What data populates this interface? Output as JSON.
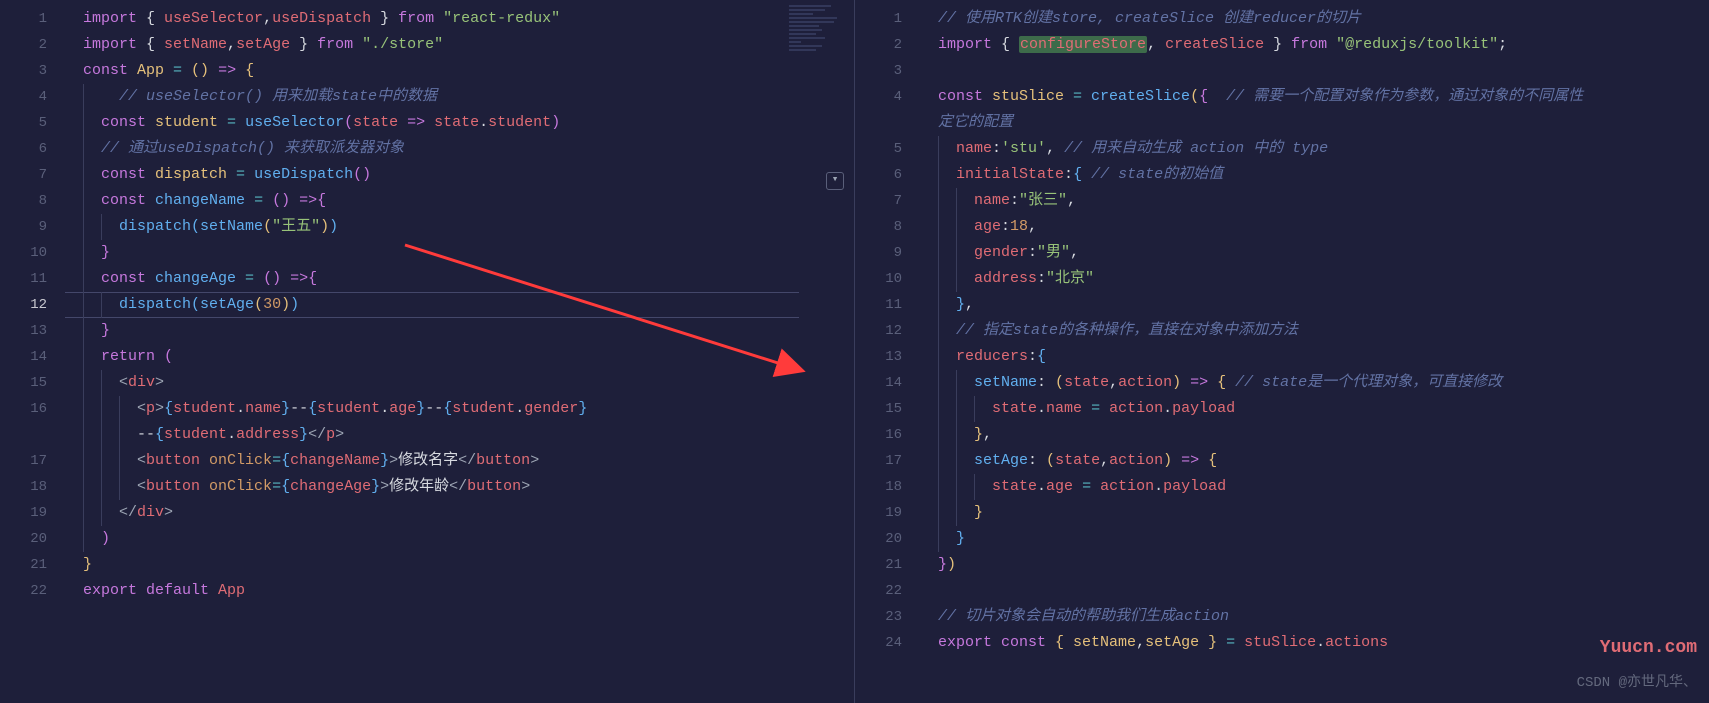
{
  "left": {
    "line_count": 22,
    "current_line": 12,
    "tokens": {
      "l1": [
        {
          "c": "k-purple",
          "t": "import "
        },
        {
          "c": "k-punc",
          "t": "{ "
        },
        {
          "c": "k-red",
          "t": "useSelector"
        },
        {
          "c": "k-punc",
          "t": ","
        },
        {
          "c": "k-red",
          "t": "useDispatch "
        },
        {
          "c": "k-punc",
          "t": "} "
        },
        {
          "c": "k-purple",
          "t": "from "
        },
        {
          "c": "k-green",
          "t": "\"react-redux\""
        }
      ],
      "l2": [
        {
          "c": "k-purple",
          "t": "import "
        },
        {
          "c": "k-punc",
          "t": "{ "
        },
        {
          "c": "k-red",
          "t": "setName"
        },
        {
          "c": "k-punc",
          "t": ","
        },
        {
          "c": "k-red",
          "t": "setAge "
        },
        {
          "c": "k-punc",
          "t": "} "
        },
        {
          "c": "k-purple",
          "t": "from "
        },
        {
          "c": "k-green",
          "t": "\"./store\""
        }
      ],
      "l3": [
        {
          "c": "k-purple",
          "t": "const "
        },
        {
          "c": "k-yellow",
          "t": "App "
        },
        {
          "c": "k-aqua",
          "t": "= "
        },
        {
          "c": "k-paren-yellow",
          "t": "() "
        },
        {
          "c": "k-purple",
          "t": "=> "
        },
        {
          "c": "k-paren-yellow",
          "t": "{"
        }
      ],
      "l4": [
        {
          "c": "",
          "t": "    "
        },
        {
          "c": "k-comment",
          "t": "// useSelector() 用来加载state中的数据"
        }
      ],
      "l5": [
        {
          "c": "",
          "t": "  "
        },
        {
          "c": "k-purple",
          "t": "const "
        },
        {
          "c": "k-yellow",
          "t": "student "
        },
        {
          "c": "k-aqua",
          "t": "= "
        },
        {
          "c": "k-blue",
          "t": "useSelector"
        },
        {
          "c": "k-paren-purple",
          "t": "("
        },
        {
          "c": "k-red",
          "t": "state "
        },
        {
          "c": "k-purple",
          "t": "=> "
        },
        {
          "c": "k-red",
          "t": "state"
        },
        {
          "c": "k-punc",
          "t": "."
        },
        {
          "c": "k-red",
          "t": "student"
        },
        {
          "c": "k-paren-purple",
          "t": ")"
        }
      ],
      "l6": [
        {
          "c": "",
          "t": "  "
        },
        {
          "c": "k-comment",
          "t": "// 通过useDispatch() 来获取派发器对象"
        }
      ],
      "l7": [
        {
          "c": "",
          "t": "  "
        },
        {
          "c": "k-purple",
          "t": "const "
        },
        {
          "c": "k-yellow",
          "t": "dispatch "
        },
        {
          "c": "k-aqua",
          "t": "= "
        },
        {
          "c": "k-blue",
          "t": "useDispatch"
        },
        {
          "c": "k-paren-purple",
          "t": "()"
        }
      ],
      "l8": [
        {
          "c": "",
          "t": "  "
        },
        {
          "c": "k-purple",
          "t": "const "
        },
        {
          "c": "k-blue",
          "t": "changeName "
        },
        {
          "c": "k-aqua",
          "t": "= "
        },
        {
          "c": "k-paren-purple",
          "t": "() "
        },
        {
          "c": "k-purple",
          "t": "=>"
        },
        {
          "c": "k-paren-purple",
          "t": "{"
        }
      ],
      "l9": [
        {
          "c": "",
          "t": "    "
        },
        {
          "c": "k-blue",
          "t": "dispatch"
        },
        {
          "c": "k-paren-blue",
          "t": "("
        },
        {
          "c": "k-blue",
          "t": "setName"
        },
        {
          "c": "k-paren-yellow",
          "t": "("
        },
        {
          "c": "k-green",
          "t": "\"王五\""
        },
        {
          "c": "k-paren-yellow",
          "t": ")"
        },
        {
          "c": "k-paren-blue",
          "t": ")"
        }
      ],
      "l10": [
        {
          "c": "",
          "t": "  "
        },
        {
          "c": "k-paren-purple",
          "t": "}"
        }
      ],
      "l11": [
        {
          "c": "",
          "t": "  "
        },
        {
          "c": "k-purple",
          "t": "const "
        },
        {
          "c": "k-blue",
          "t": "changeAge "
        },
        {
          "c": "k-aqua",
          "t": "= "
        },
        {
          "c": "k-paren-purple",
          "t": "() "
        },
        {
          "c": "k-purple",
          "t": "=>"
        },
        {
          "c": "k-paren-purple",
          "t": "{"
        }
      ],
      "l12": [
        {
          "c": "",
          "t": "    "
        },
        {
          "c": "k-blue",
          "t": "dispatch"
        },
        {
          "c": "k-paren-blue",
          "t": "("
        },
        {
          "c": "k-blue",
          "t": "setAge"
        },
        {
          "c": "k-paren-yellow",
          "t": "("
        },
        {
          "c": "k-orange",
          "t": "30"
        },
        {
          "c": "k-paren-yellow",
          "t": ")"
        },
        {
          "c": "k-paren-blue",
          "t": ")"
        }
      ],
      "l13": [
        {
          "c": "",
          "t": "  "
        },
        {
          "c": "k-paren-purple",
          "t": "}"
        }
      ],
      "l14": [
        {
          "c": "",
          "t": "  "
        },
        {
          "c": "k-purple",
          "t": "return "
        },
        {
          "c": "k-paren-purple",
          "t": "("
        }
      ],
      "l15": [
        {
          "c": "",
          "t": "    "
        },
        {
          "c": "k-gray",
          "t": "<"
        },
        {
          "c": "k-tag",
          "t": "div"
        },
        {
          "c": "k-gray",
          "t": ">"
        }
      ],
      "l16": [
        {
          "c": "",
          "t": "      "
        },
        {
          "c": "k-gray",
          "t": "<"
        },
        {
          "c": "k-tag",
          "t": "p"
        },
        {
          "c": "k-gray",
          "t": ">"
        },
        {
          "c": "k-paren-blue",
          "t": "{"
        },
        {
          "c": "k-red",
          "t": "student"
        },
        {
          "c": "k-punc",
          "t": "."
        },
        {
          "c": "k-red",
          "t": "name"
        },
        {
          "c": "k-paren-blue",
          "t": "}"
        },
        {
          "c": "k-white",
          "t": "--"
        },
        {
          "c": "k-paren-blue",
          "t": "{"
        },
        {
          "c": "k-red",
          "t": "student"
        },
        {
          "c": "k-punc",
          "t": "."
        },
        {
          "c": "k-red",
          "t": "age"
        },
        {
          "c": "k-paren-blue",
          "t": "}"
        },
        {
          "c": "k-white",
          "t": "--"
        },
        {
          "c": "k-paren-blue",
          "t": "{"
        },
        {
          "c": "k-red",
          "t": "student"
        },
        {
          "c": "k-punc",
          "t": "."
        },
        {
          "c": "k-red",
          "t": "gender"
        },
        {
          "c": "k-paren-blue",
          "t": "}"
        }
      ],
      "l16b": [
        {
          "c": "",
          "t": "      "
        },
        {
          "c": "k-white",
          "t": "--"
        },
        {
          "c": "k-paren-blue",
          "t": "{"
        },
        {
          "c": "k-red",
          "t": "student"
        },
        {
          "c": "k-punc",
          "t": "."
        },
        {
          "c": "k-red",
          "t": "address"
        },
        {
          "c": "k-paren-blue",
          "t": "}"
        },
        {
          "c": "k-gray",
          "t": "</"
        },
        {
          "c": "k-tag",
          "t": "p"
        },
        {
          "c": "k-gray",
          "t": ">"
        }
      ],
      "l17": [
        {
          "c": "",
          "t": "      "
        },
        {
          "c": "k-gray",
          "t": "<"
        },
        {
          "c": "k-tag",
          "t": "button "
        },
        {
          "c": "k-attr",
          "t": "onClick"
        },
        {
          "c": "k-aqua",
          "t": "="
        },
        {
          "c": "k-paren-blue",
          "t": "{"
        },
        {
          "c": "k-red",
          "t": "changeName"
        },
        {
          "c": "k-paren-blue",
          "t": "}"
        },
        {
          "c": "k-gray",
          "t": ">"
        },
        {
          "c": "k-white",
          "t": "修改名字"
        },
        {
          "c": "k-gray",
          "t": "</"
        },
        {
          "c": "k-tag",
          "t": "button"
        },
        {
          "c": "k-gray",
          "t": ">"
        }
      ],
      "l18": [
        {
          "c": "",
          "t": "      "
        },
        {
          "c": "k-gray",
          "t": "<"
        },
        {
          "c": "k-tag",
          "t": "button "
        },
        {
          "c": "k-attr",
          "t": "onClick"
        },
        {
          "c": "k-aqua",
          "t": "="
        },
        {
          "c": "k-paren-blue",
          "t": "{"
        },
        {
          "c": "k-red",
          "t": "changeAge"
        },
        {
          "c": "k-paren-blue",
          "t": "}"
        },
        {
          "c": "k-gray",
          "t": ">"
        },
        {
          "c": "k-white",
          "t": "修改年龄"
        },
        {
          "c": "k-gray",
          "t": "</"
        },
        {
          "c": "k-tag",
          "t": "button"
        },
        {
          "c": "k-gray",
          "t": ">"
        }
      ],
      "l19": [
        {
          "c": "",
          "t": "    "
        },
        {
          "c": "k-gray",
          "t": "</"
        },
        {
          "c": "k-tag",
          "t": "div"
        },
        {
          "c": "k-gray",
          "t": ">"
        }
      ],
      "l20": [
        {
          "c": "",
          "t": "  "
        },
        {
          "c": "k-paren-purple",
          "t": ")"
        }
      ],
      "l21": [
        {
          "c": "k-paren-yellow",
          "t": "}"
        }
      ],
      "l22": [
        {
          "c": "k-purple",
          "t": "export default "
        },
        {
          "c": "k-red",
          "t": "App"
        }
      ]
    }
  },
  "right": {
    "line_count": 24,
    "tokens": {
      "r1": [
        {
          "c": "k-comment",
          "t": "// 使用RTK创建store, createSlice 创建reducer的切片"
        }
      ],
      "r2": [
        {
          "c": "k-purple",
          "t": "import "
        },
        {
          "c": "k-punc",
          "t": "{ "
        },
        {
          "c": "k-red hl-sel",
          "t": "configureStore"
        },
        {
          "c": "k-punc",
          "t": ", "
        },
        {
          "c": "k-red",
          "t": "createSlice "
        },
        {
          "c": "k-punc",
          "t": "} "
        },
        {
          "c": "k-purple",
          "t": "from "
        },
        {
          "c": "k-green",
          "t": "\"@reduxjs/toolkit\""
        },
        {
          "c": "k-punc",
          "t": ";"
        }
      ],
      "r3": [],
      "r4": [
        {
          "c": "k-purple",
          "t": "const "
        },
        {
          "c": "k-yellow",
          "t": "stuSlice "
        },
        {
          "c": "k-aqua",
          "t": "= "
        },
        {
          "c": "k-blue",
          "t": "createSlice"
        },
        {
          "c": "k-paren-yellow",
          "t": "("
        },
        {
          "c": "k-paren-purple",
          "t": "{  "
        },
        {
          "c": "k-comment",
          "t": "// 需要一个配置对象作为参数，通过对象的不同属性"
        }
      ],
      "r4b": [
        {
          "c": "k-comment",
          "t": "定它的配置"
        }
      ],
      "r5": [
        {
          "c": "",
          "t": "  "
        },
        {
          "c": "k-red",
          "t": "name"
        },
        {
          "c": "k-punc",
          "t": ":"
        },
        {
          "c": "k-green",
          "t": "'stu'"
        },
        {
          "c": "k-punc",
          "t": ", "
        },
        {
          "c": "k-comment",
          "t": "// 用来自动生成 action 中的 type"
        }
      ],
      "r6": [
        {
          "c": "",
          "t": "  "
        },
        {
          "c": "k-red",
          "t": "initialState"
        },
        {
          "c": "k-punc",
          "t": ":"
        },
        {
          "c": "k-paren-blue",
          "t": "{ "
        },
        {
          "c": "k-comment",
          "t": "// state的初始值"
        }
      ],
      "r7": [
        {
          "c": "",
          "t": "    "
        },
        {
          "c": "k-red",
          "t": "name"
        },
        {
          "c": "k-punc",
          "t": ":"
        },
        {
          "c": "k-green",
          "t": "\"张三\""
        },
        {
          "c": "k-punc",
          "t": ","
        }
      ],
      "r8": [
        {
          "c": "",
          "t": "    "
        },
        {
          "c": "k-red",
          "t": "age"
        },
        {
          "c": "k-punc",
          "t": ":"
        },
        {
          "c": "k-orange",
          "t": "18"
        },
        {
          "c": "k-punc",
          "t": ","
        }
      ],
      "r9": [
        {
          "c": "",
          "t": "    "
        },
        {
          "c": "k-red",
          "t": "gender"
        },
        {
          "c": "k-punc",
          "t": ":"
        },
        {
          "c": "k-green",
          "t": "\"男\""
        },
        {
          "c": "k-punc",
          "t": ","
        }
      ],
      "r10": [
        {
          "c": "",
          "t": "    "
        },
        {
          "c": "k-red",
          "t": "address"
        },
        {
          "c": "k-punc",
          "t": ":"
        },
        {
          "c": "k-green",
          "t": "\"北京\""
        }
      ],
      "r11": [
        {
          "c": "",
          "t": "  "
        },
        {
          "c": "k-paren-blue",
          "t": "}"
        },
        {
          "c": "k-punc",
          "t": ","
        }
      ],
      "r12": [
        {
          "c": "",
          "t": "  "
        },
        {
          "c": "k-comment",
          "t": "// 指定state的各种操作，直接在对象中添加方法"
        }
      ],
      "r13": [
        {
          "c": "",
          "t": "  "
        },
        {
          "c": "k-red",
          "t": "reducers"
        },
        {
          "c": "k-punc",
          "t": ":"
        },
        {
          "c": "k-paren-blue",
          "t": "{"
        }
      ],
      "r14": [
        {
          "c": "",
          "t": "    "
        },
        {
          "c": "k-blue",
          "t": "setName"
        },
        {
          "c": "k-punc",
          "t": ": "
        },
        {
          "c": "k-paren-yellow",
          "t": "("
        },
        {
          "c": "k-red",
          "t": "state"
        },
        {
          "c": "k-punc",
          "t": ","
        },
        {
          "c": "k-red",
          "t": "action"
        },
        {
          "c": "k-paren-yellow",
          "t": ") "
        },
        {
          "c": "k-purple",
          "t": "=> "
        },
        {
          "c": "k-paren-yellow",
          "t": "{ "
        },
        {
          "c": "k-comment",
          "t": "// state是一个代理对象，可直接修改"
        }
      ],
      "r15": [
        {
          "c": "",
          "t": "      "
        },
        {
          "c": "k-red",
          "t": "state"
        },
        {
          "c": "k-punc",
          "t": "."
        },
        {
          "c": "k-red",
          "t": "name "
        },
        {
          "c": "k-aqua",
          "t": "= "
        },
        {
          "c": "k-red",
          "t": "action"
        },
        {
          "c": "k-punc",
          "t": "."
        },
        {
          "c": "k-red",
          "t": "payload"
        }
      ],
      "r16": [
        {
          "c": "",
          "t": "    "
        },
        {
          "c": "k-paren-yellow",
          "t": "}"
        },
        {
          "c": "k-punc",
          "t": ","
        }
      ],
      "r17": [
        {
          "c": "",
          "t": "    "
        },
        {
          "c": "k-blue",
          "t": "setAge"
        },
        {
          "c": "k-punc",
          "t": ": "
        },
        {
          "c": "k-paren-yellow",
          "t": "("
        },
        {
          "c": "k-red",
          "t": "state"
        },
        {
          "c": "k-punc",
          "t": ","
        },
        {
          "c": "k-red",
          "t": "action"
        },
        {
          "c": "k-paren-yellow",
          "t": ") "
        },
        {
          "c": "k-purple",
          "t": "=> "
        },
        {
          "c": "k-paren-yellow",
          "t": "{"
        }
      ],
      "r18": [
        {
          "c": "",
          "t": "      "
        },
        {
          "c": "k-red",
          "t": "state"
        },
        {
          "c": "k-punc",
          "t": "."
        },
        {
          "c": "k-red",
          "t": "age "
        },
        {
          "c": "k-aqua",
          "t": "= "
        },
        {
          "c": "k-red",
          "t": "action"
        },
        {
          "c": "k-punc",
          "t": "."
        },
        {
          "c": "k-red",
          "t": "payload"
        }
      ],
      "r19": [
        {
          "c": "",
          "t": "    "
        },
        {
          "c": "k-paren-yellow",
          "t": "}"
        }
      ],
      "r20": [
        {
          "c": "",
          "t": "  "
        },
        {
          "c": "k-paren-blue",
          "t": "}"
        }
      ],
      "r21": [
        {
          "c": "k-paren-purple",
          "t": "}"
        },
        {
          "c": "k-paren-yellow",
          "t": ")"
        }
      ],
      "r22": [],
      "r23": [
        {
          "c": "k-comment",
          "t": "// 切片对象会自动的帮助我们生成action"
        }
      ],
      "r24": [
        {
          "c": "k-purple",
          "t": "export const "
        },
        {
          "c": "k-paren-yellow",
          "t": "{ "
        },
        {
          "c": "k-yellow",
          "t": "setName"
        },
        {
          "c": "k-punc",
          "t": ","
        },
        {
          "c": "k-yellow",
          "t": "setAge "
        },
        {
          "c": "k-paren-yellow",
          "t": "} "
        },
        {
          "c": "k-aqua",
          "t": "= "
        },
        {
          "c": "k-red",
          "t": "stuSlice"
        },
        {
          "c": "k-punc",
          "t": "."
        },
        {
          "c": "k-red",
          "t": "actions"
        }
      ]
    }
  },
  "watermarks": {
    "csdn": "CSDN @亦世凡华、",
    "yuucn": "Yuucn.com"
  },
  "collapse_glyph": "▾"
}
